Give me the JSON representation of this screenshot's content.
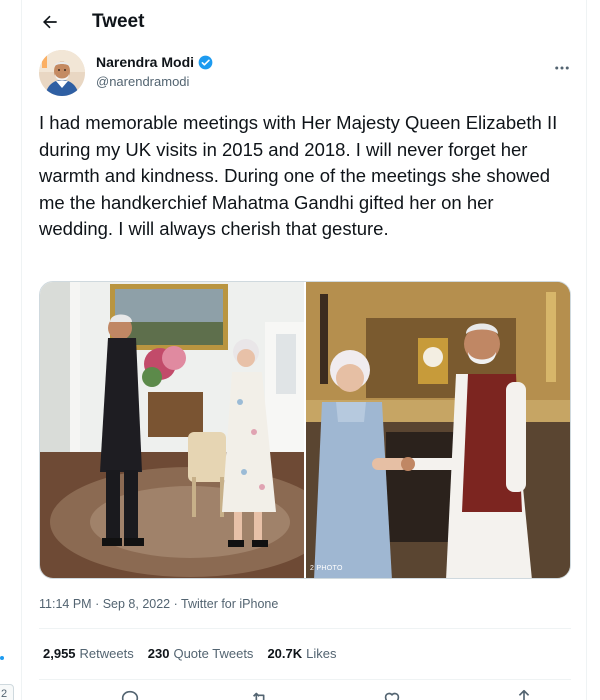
{
  "header": {
    "title": "Tweet",
    "back_icon": "arrow-left-icon"
  },
  "author": {
    "name": "Narendra Modi",
    "handle": "@narendramodi",
    "verified": true,
    "verified_color": "#1d9bf0",
    "more_icon": "more-horizontal-icon"
  },
  "tweet": {
    "text": "I had memorable meetings with Her Majesty Queen Elizabeth II during my UK visits in 2015 and 2018. I will never forget her warmth and kindness. During one of the meetings she showed me the handkerchief Mahatma Gandhi gifted her on her wedding. I will always cherish that gesture.",
    "photo_credit": "2 PHOTO"
  },
  "meta": {
    "time": "11:14 PM",
    "separator": "·",
    "date": "Sep 8, 2022",
    "source": "Twitter for iPhone"
  },
  "stats": {
    "retweets_value": "2,955",
    "retweets_label": "Retweets",
    "quotes_value": "230",
    "quotes_label": "Quote Tweets",
    "likes_value": "20.7K",
    "likes_label": "Likes"
  },
  "actions": [
    "reply-icon",
    "retweet-icon",
    "like-icon",
    "share-icon"
  ],
  "sidebar": {
    "badge": "2"
  },
  "colors": {
    "accent": "#1d9bf0",
    "text": "#0f1419",
    "secondary": "#536471",
    "border": "#eff3f4"
  }
}
